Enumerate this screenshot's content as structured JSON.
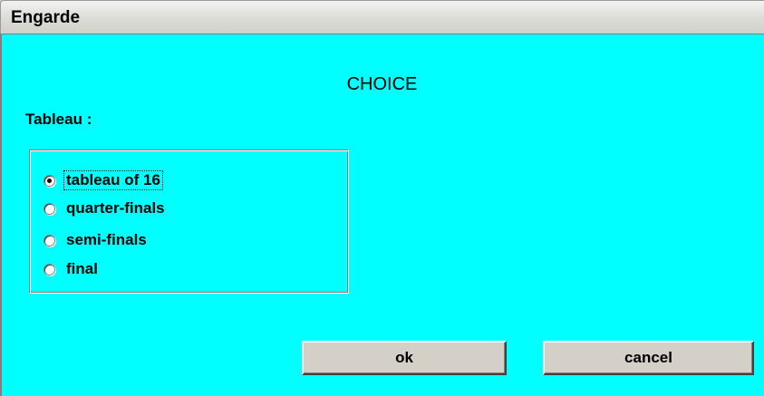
{
  "window": {
    "title": "Engarde",
    "background_color": "#00ffff"
  },
  "dialog": {
    "heading": "CHOICE",
    "group_label": "Tableau :",
    "options": [
      {
        "label": "tableau of 16",
        "selected": true,
        "focused": true
      },
      {
        "label": "quarter-finals",
        "selected": false,
        "focused": false
      },
      {
        "label": "semi-finals",
        "selected": false,
        "focused": false
      },
      {
        "label": "final",
        "selected": false,
        "focused": false
      }
    ]
  },
  "buttons": {
    "ok_label": "ok",
    "cancel_label": "cancel"
  }
}
